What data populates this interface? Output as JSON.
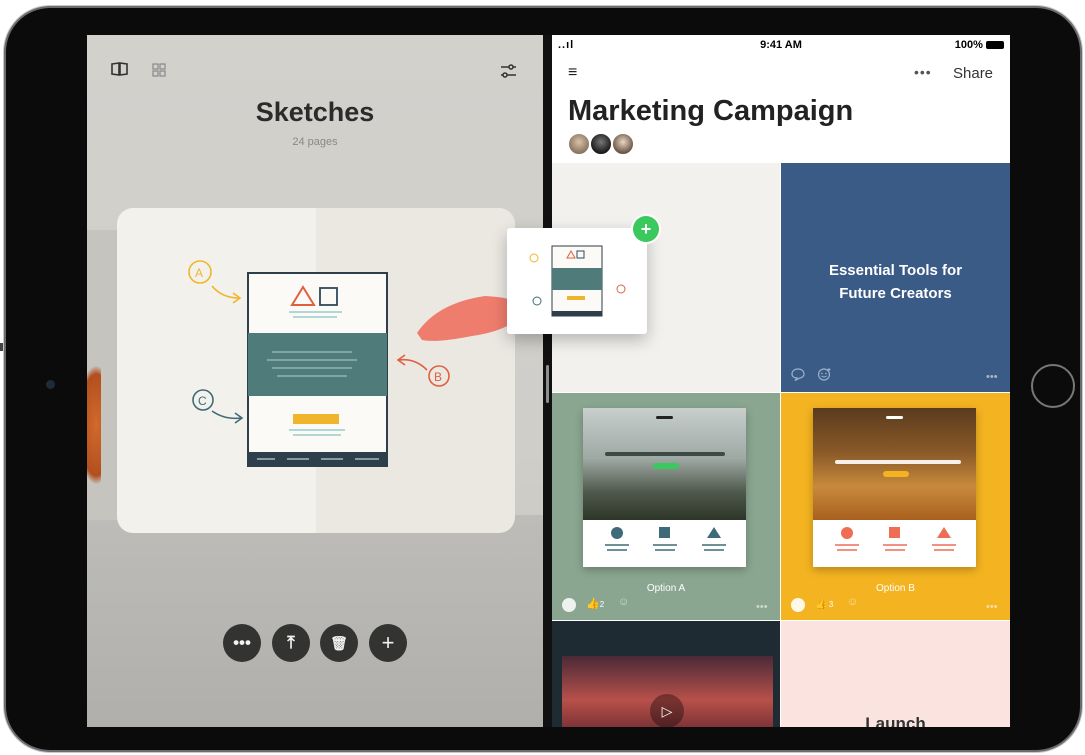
{
  "left_pane": {
    "title": "Sketches",
    "subtitle": "24 pages",
    "toolbar_icons": [
      "book-icon",
      "grid-icon",
      "sliders-icon"
    ],
    "actions": [
      {
        "name": "more-button",
        "glyph": "•••"
      },
      {
        "name": "export-button",
        "glyph": "⤒"
      },
      {
        "name": "delete-button",
        "glyph": "🗑"
      },
      {
        "name": "add-button",
        "glyph": "+"
      }
    ],
    "sketch_labels": {
      "a": "A",
      "b": "B",
      "c": "C"
    }
  },
  "status_bar": {
    "signal": "..ıl",
    "time": "9:41 AM",
    "battery": "100%"
  },
  "right_pane": {
    "menu_glyph": "≡",
    "more_glyph": "•••",
    "share_label": "Share",
    "title": "Marketing Campaign",
    "tiles": {
      "essential": {
        "title_line1": "Essential Tools for",
        "title_line2": "Future Creators"
      },
      "option_a": {
        "caption": "Option A",
        "likes": "2"
      },
      "option_b": {
        "caption": "Option B",
        "likes": "3"
      },
      "launch": {
        "title": "Launch"
      }
    }
  },
  "drag_card": {
    "badge": "+"
  },
  "colors": {
    "blue_tile": "#3a5b85",
    "green_tile": "#8aa690",
    "yellow_tile": "#f4b321",
    "dark_tile": "#1f2b33",
    "pink_tile": "#fbe4e0",
    "teal": "#4f7b7a",
    "accent_red": "#ef7d6d",
    "badge_green": "#3bc85d"
  }
}
